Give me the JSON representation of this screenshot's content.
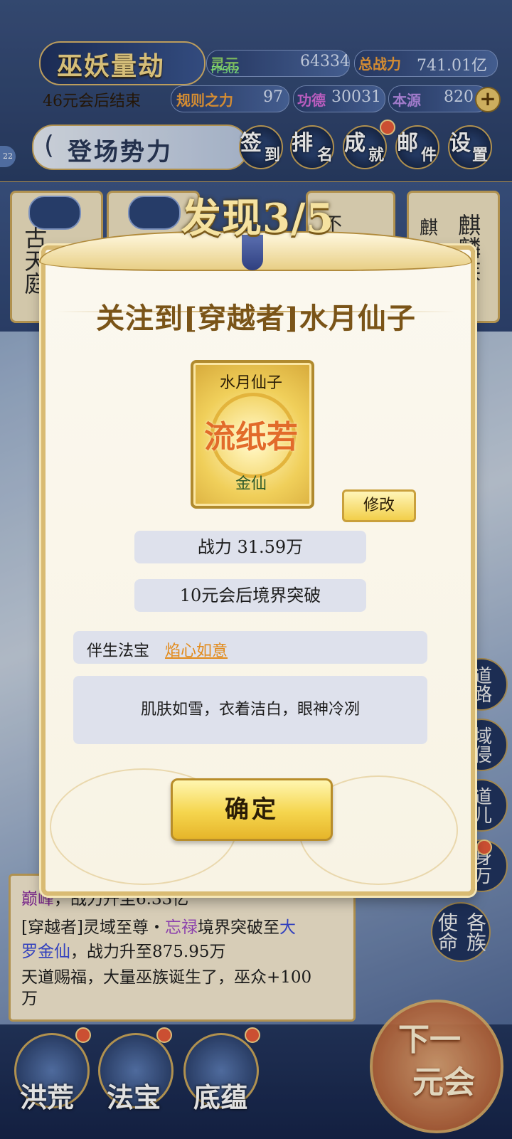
{
  "hud": {
    "title": "巫妖量劫",
    "countdown": "46元会后结束",
    "fps": "FPS62",
    "stats": [
      {
        "label": "灵元",
        "value": "64334",
        "color": "#8fd46a"
      },
      {
        "label": "总战力",
        "value": "741.01亿",
        "color": "#f2a03a"
      },
      {
        "label": "规则之力",
        "value": "97",
        "color": "#f2a03a"
      },
      {
        "label": "功德",
        "value": "30031",
        "color": "#d36ad9"
      },
      {
        "label": "本源",
        "value": "820",
        "color": "#b88de8"
      }
    ],
    "faction_label": "登场势力",
    "side_badge": "22",
    "nav": [
      {
        "c1": "签",
        "c2": "到"
      },
      {
        "c1": "排",
        "c2": "名"
      },
      {
        "c1": "成",
        "c2": "就"
      },
      {
        "c1": "邮",
        "c2": "件"
      },
      {
        "c1": "设",
        "c2": "置"
      }
    ]
  },
  "bg_cards": {
    "card1": "古天庭",
    "card5": "麒麟族",
    "card5_prefix": "麒",
    "card3_partial": "不"
  },
  "side_buttons": [
    "道路",
    "域侵",
    "道儿",
    "身万",
    "各族使命"
  ],
  "log": {
    "line1_a": "巅峰",
    "line1_b": "，战力升至6.33亿",
    "line2_a": "[穿越者]灵域至尊・",
    "line2_name": "忘禄",
    "line2_b": "境界突破至",
    "line2_realm": "大",
    "line3_realm": "罗金仙",
    "line3_b": "，战力升至875.95万",
    "line4": "天道赐福，大量巫族诞生了，巫众+100",
    "line5": "万"
  },
  "bottom": {
    "tabs": [
      "洪荒",
      "法宝",
      "底蕴"
    ],
    "next_line1": "下一",
    "next_line2": "元会"
  },
  "dialog": {
    "discovery": "发现3/5",
    "title": "关注到[穿越者]水月仙子",
    "portrait_name": "水月仙子",
    "portrait_seal": "流纸若",
    "portrait_rank": "金仙",
    "edit_label": "修改",
    "power": "战力 31.59万",
    "breakthrough": "10元会后境界突破",
    "weapon_label": "伴生法宝",
    "weapon_name": "焰心如意",
    "description": "肌肤如雪，衣着洁白，眼神冷冽",
    "confirm_label": "确定"
  },
  "colors": {
    "accent_gold": "#d9bb73",
    "dialog_bg": "#fbf8ef",
    "title_brown": "#7a5418",
    "link_orange": "#e28a1a"
  }
}
